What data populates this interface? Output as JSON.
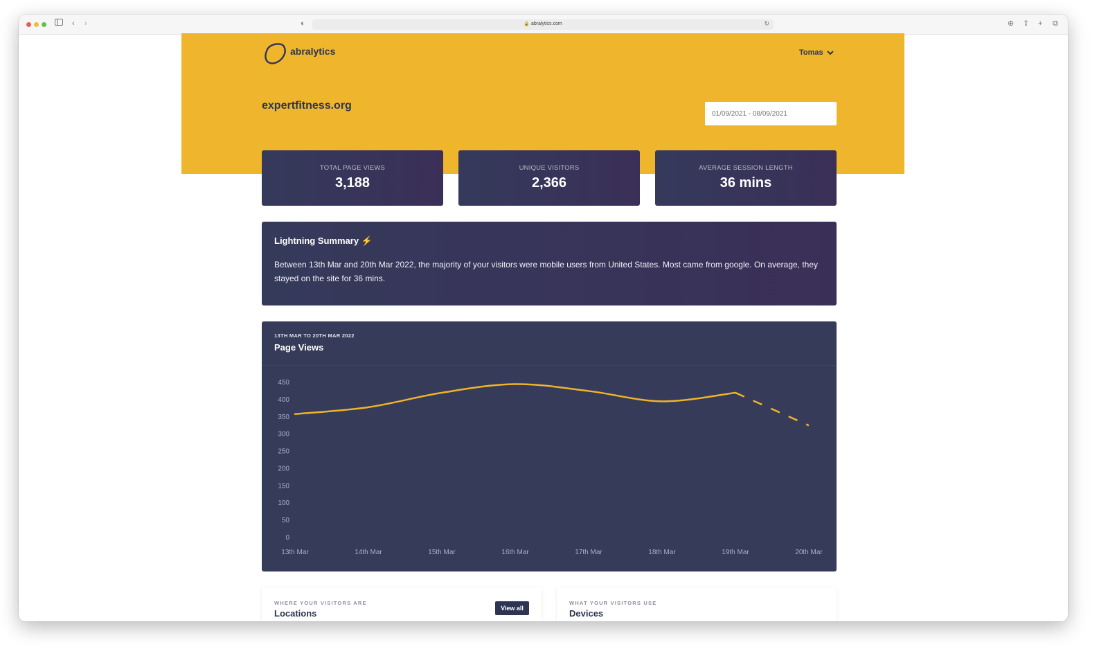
{
  "browser": {
    "url": "abralytics.com",
    "traffic_colors": [
      "#ee5b52",
      "#f4bc3a",
      "#5bc646"
    ]
  },
  "header": {
    "brand": "abralytics",
    "user": "Tomas",
    "site": "expertfitness.org",
    "date_range_placeholder": "01/09/2021 - 08/09/2021",
    "accent_color": "#efb62d"
  },
  "stats": [
    {
      "label": "TOTAL PAGE VIEWS",
      "value": "3,188"
    },
    {
      "label": "UNIQUE VISITORS",
      "value": "2,366"
    },
    {
      "label": "AVERAGE SESSION LENGTH",
      "value": "36 mins"
    }
  ],
  "summary": {
    "title": "Lightning Summary ⚡",
    "text": "Between 13th Mar and 20th Mar 2022, the majority of your visitors were mobile users from United States. Most came from google. On average, they stayed on the site for 36 mins."
  },
  "chart": {
    "kicker": "13TH MAR TO 20TH MAR 2022",
    "title": "Page Views"
  },
  "chart_data": {
    "type": "line",
    "categories": [
      "13th Mar",
      "14th Mar",
      "15th Mar",
      "16th Mar",
      "17th Mar",
      "18th Mar",
      "19th Mar",
      "20th Mar"
    ],
    "values": [
      358,
      378,
      420,
      445,
      425,
      395,
      420,
      325
    ],
    "dashed_from_index": 6,
    "ylim": [
      0,
      450
    ],
    "yticks": [
      0,
      50,
      100,
      150,
      200,
      250,
      300,
      350,
      400,
      450
    ],
    "line_color": "#f0b429",
    "grid": false
  },
  "panels": {
    "locations": {
      "kicker": "WHERE YOUR VISITORS ARE",
      "title": "Locations",
      "button": "View all"
    },
    "devices": {
      "kicker": "WHAT YOUR VISITORS USE",
      "title": "Devices"
    }
  }
}
